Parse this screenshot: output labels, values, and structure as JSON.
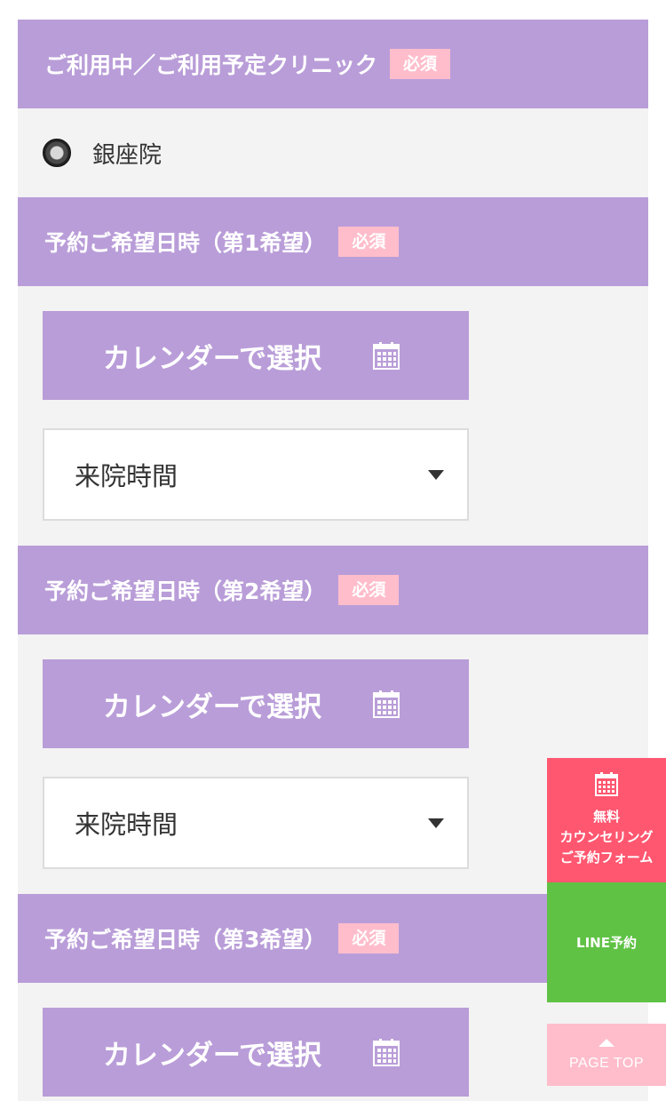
{
  "clinic_section": {
    "title": "ご利用中／ご利用予定クリニック",
    "required": "必須",
    "options": [
      {
        "label": "銀座院",
        "selected": true
      }
    ]
  },
  "date_sections": [
    {
      "title": "予約ご希望日時（第1希望）",
      "required": "必須",
      "calendar_button": "カレンダーで選択",
      "time_select": {
        "selected": "来院時間"
      }
    },
    {
      "title": "予約ご希望日時（第2希望）",
      "required": "必須",
      "calendar_button": "カレンダーで選択",
      "time_select": {
        "selected": "来院時間"
      }
    },
    {
      "title": "予約ご希望日時（第3希望）",
      "required": "必須",
      "calendar_button": "カレンダーで選択"
    }
  ],
  "side_nav": {
    "counseling": {
      "lines": [
        "無料",
        "カウンセリング",
        "ご予約フォーム"
      ],
      "icon": "calendar-icon"
    },
    "line_booking": {
      "label": "LINE予約"
    },
    "page_top": {
      "label": "PAGE TOP",
      "icon": "arrow-up-icon"
    }
  },
  "colors": {
    "header_bg": "#b99dd8",
    "required_badge": "#ffbdcb",
    "section_bg": "#f3f3f3",
    "counseling_bg": "#ff5770",
    "line_bg": "#5fc245",
    "page_top_bg": "#ffbdcb"
  }
}
